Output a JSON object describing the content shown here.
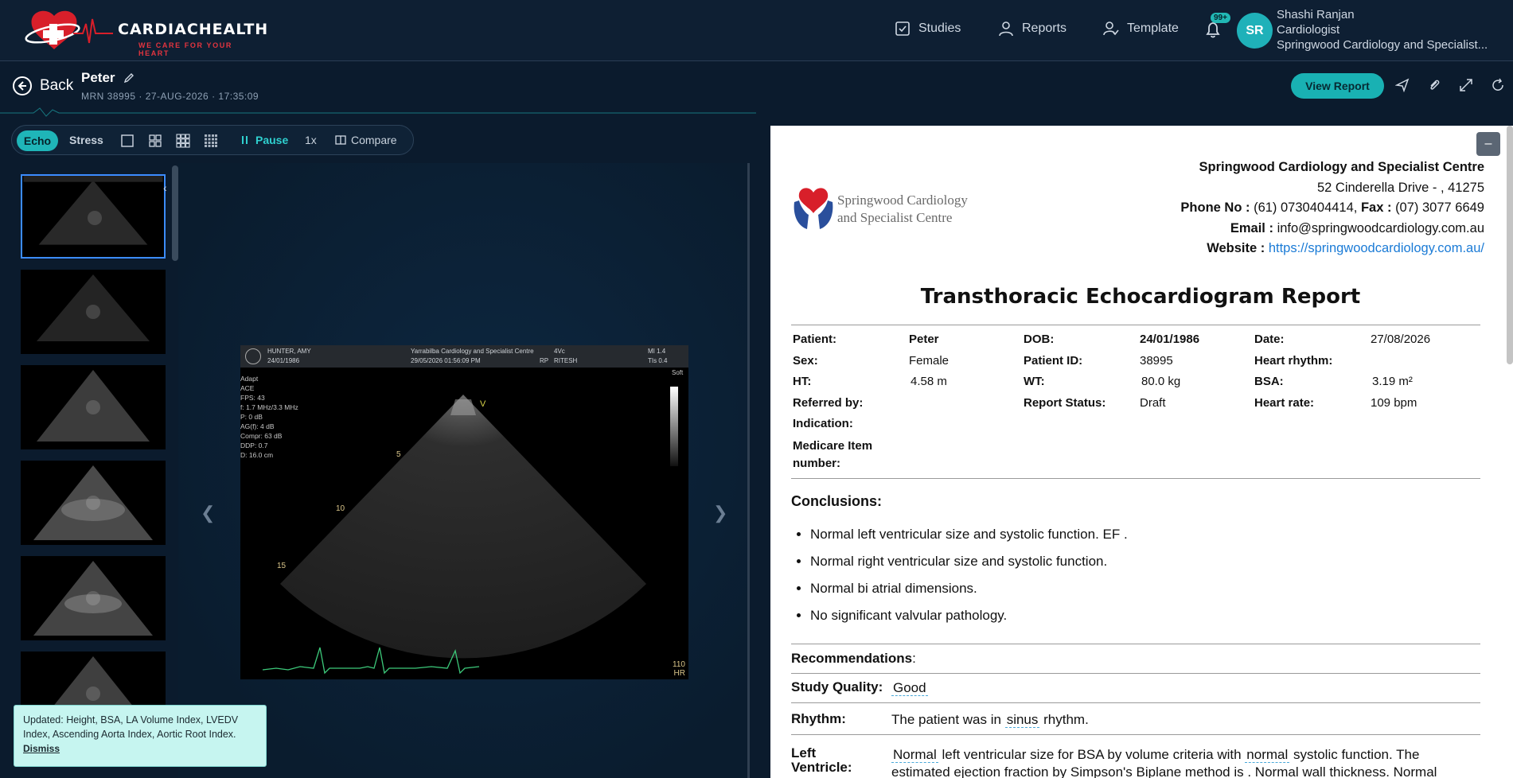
{
  "header": {
    "brand": "CARDIACHEALTH",
    "tagline": "WE CARE FOR YOUR HEART",
    "nav": [
      {
        "label": "Studies",
        "icon": "clipboard-check-icon"
      },
      {
        "label": "Reports",
        "icon": "user-icon"
      },
      {
        "label": "Template",
        "icon": "user-check-icon"
      }
    ],
    "notifications_badge": "99+",
    "user": {
      "initials": "SR",
      "name": "Shashi Ranjan",
      "role": "Cardiologist",
      "org": "Springwood Cardiology and Specialist..."
    }
  },
  "patient_bar": {
    "back_label": "Back",
    "patient_name": "Peter",
    "meta": "MRN 38995 · 27-AUG-2026 · 17:35:09",
    "view_report_label": "View Report"
  },
  "toolbar": {
    "echo_label": "Echo",
    "stress_label": "Stress",
    "pause_label": "Pause",
    "speed_label": "1x",
    "compare_label": "Compare"
  },
  "viewer": {
    "us_patient": "HUNTER, AMY",
    "us_dob": "24/01/1986",
    "us_clinic": "Yarrabilba Cardiology and Specialist Centre",
    "us_datetime": "29/05/2026 01:56:09 PM",
    "us_probe": "4Vc",
    "us_rp": "RP",
    "us_operator": "RITESH",
    "us_mi": "MI 1.4",
    "us_tis": "TIs 0.4",
    "us_soft": "Soft",
    "us_params": [
      "Adapt",
      "ACE",
      "FPS: 43",
      "f: 1.7 MHz/3.3 MHz",
      "P: 0 dB",
      "AG(f): 4 dB",
      "Compr: 63 dB",
      "DDP: 0.7",
      "D: 16.0 cm"
    ],
    "us_depths": [
      "5",
      "10",
      "15"
    ],
    "us_hr_value": "110",
    "us_hr_label": "HR",
    "us_marker": "V"
  },
  "toast": {
    "message": "Updated: Height, BSA, LA Volume Index, LVEDV Index, Ascending Aorta Index, Aortic Root Index.",
    "dismiss_label": "Dismiss"
  },
  "report": {
    "minimize_label": "–",
    "clinic_logo_line1": "Springwood Cardiology",
    "clinic_logo_line2": "and Specialist Centre",
    "clinic_name": "Springwood Cardiology and Specialist Centre",
    "address": "52 Cinderella Drive - , 41275",
    "phone_label": "Phone No :",
    "phone": "(61) 0730404414,",
    "fax_label": "Fax :",
    "fax": "(07) 3077 6649",
    "email_label": "Email :",
    "email": "info@springwoodcardiology.com.au",
    "website_label": "Website :",
    "website": "https://springwoodcardiology.com.au/",
    "title": "Transthoracic Echocardiogram Report",
    "fields": {
      "patient_l": "Patient:",
      "patient_v": "Peter",
      "dob_l": "DOB:",
      "dob_v": "24/01/1986",
      "date_l": "Date:",
      "date_v": "27/08/2026",
      "sex_l": "Sex:",
      "sex_v": "Female",
      "pid_l": "Patient ID:",
      "pid_v": "38995",
      "rhythm_l": "Heart rhythm:",
      "ht_l": "HT:",
      "ht_v": "4.58 m",
      "wt_l": "WT:",
      "wt_v": "80.0 kg",
      "bsa_l": "BSA:",
      "bsa_v": "3.19 m²",
      "ref_l": "Referred by:",
      "status_l": "Report Status:",
      "status_v": "Draft",
      "hr_l": "Heart rate:",
      "hr_v": "109 bpm",
      "ind_l": "Indication:",
      "medicare_l1": "Medicare Item",
      "medicare_l2": "number:"
    },
    "conclusions_head": "Conclusions:",
    "conclusions": [
      "Normal left ventricular size and systolic function. EF .",
      "Normal right ventricular size and systolic function.",
      "Normal bi atrial dimensions.",
      "No significant valvular pathology."
    ],
    "recommendations_head": "Recommendations",
    "recommendations_colon": ":",
    "quality_label": "Study Quality:",
    "quality_value": "Good",
    "rhythm_label": "Rhythm:",
    "rhythm_pre": "The patient was in",
    "rhythm_value": "sinus",
    "rhythm_post": "rhythm.",
    "lv_label1": "Left",
    "lv_label2": "Ventricle:",
    "lv_v1": "Normal",
    "lv_t1": "left ventricular size for BSA by volume criteria with",
    "lv_v2": "normal",
    "lv_t2": "systolic function. The",
    "lv_line2": "estimated ejection fraction by Simpson's Biplane method is . Normal wall thickness. Normal"
  },
  "colors": {
    "accent": "#1fb5b8",
    "background": "#0b1b2d",
    "brand_red": "#e3343f",
    "link": "#1b7bd6"
  }
}
